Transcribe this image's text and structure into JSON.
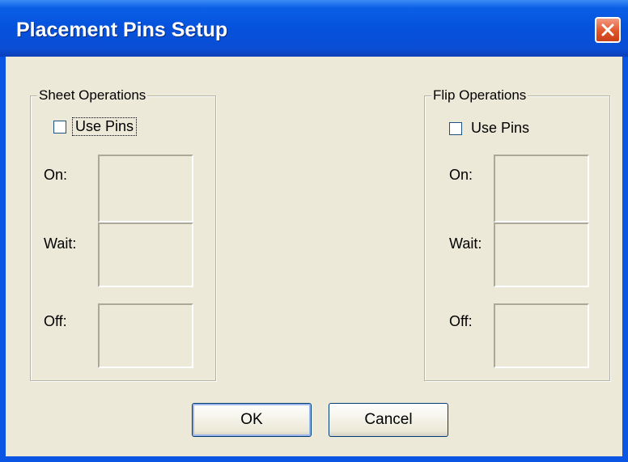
{
  "window": {
    "title": "Placement Pins Setup",
    "close_icon": "close-icon",
    "accent_color": "#0a55e3",
    "close_color": "#e0552a",
    "face_color": "#ece9d8"
  },
  "sheet": {
    "title": "Sheet Operations",
    "use_pins_label": "Use Pins",
    "use_pins_checked": false,
    "on_label": "On:",
    "wait_label": "Wait:",
    "off_label": "Off:"
  },
  "flip": {
    "title": "Flip Operations",
    "use_pins_label": "Use Pins",
    "use_pins_checked": false,
    "on_label": "On:",
    "wait_label": "Wait:",
    "off_label": "Off:"
  },
  "buttons": {
    "ok_label": "OK",
    "cancel_label": "Cancel"
  }
}
